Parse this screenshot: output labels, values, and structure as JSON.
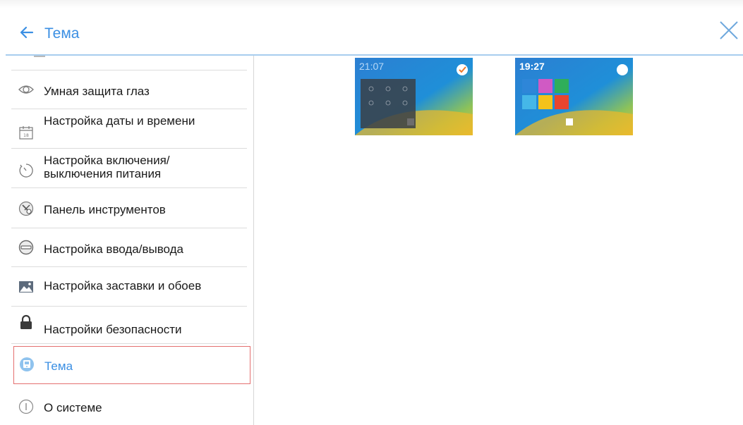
{
  "header": {
    "title": "Тема",
    "back_icon": "arrow-left-icon",
    "close_icon": "close-icon"
  },
  "sidebar": {
    "items": [
      {
        "label": "Умная защита глаз",
        "icon": "eye-icon"
      },
      {
        "label": "Настройка даты и времени",
        "icon": "calendar-icon"
      },
      {
        "label": "Настройка включения/ выключения питания",
        "icon": "timer-icon"
      },
      {
        "label": "Панель инструментов",
        "icon": "tools-icon"
      },
      {
        "label": "Настройка ввода/вывода",
        "icon": "input-output-icon"
      },
      {
        "label": "Настройка заставки и обоев",
        "icon": "image-icon"
      },
      {
        "label": "Настройки безопасности",
        "icon": "lock-icon"
      },
      {
        "label": "Тема",
        "icon": "theme-icon",
        "active": true
      },
      {
        "label": "О системе",
        "icon": "info-icon"
      }
    ]
  },
  "themes": [
    {
      "clock": "21:07",
      "selected": true
    },
    {
      "clock": "19:27",
      "selected": false
    }
  ],
  "colors": {
    "accent": "#3b8fe3",
    "active_border": "#e46f6f"
  }
}
